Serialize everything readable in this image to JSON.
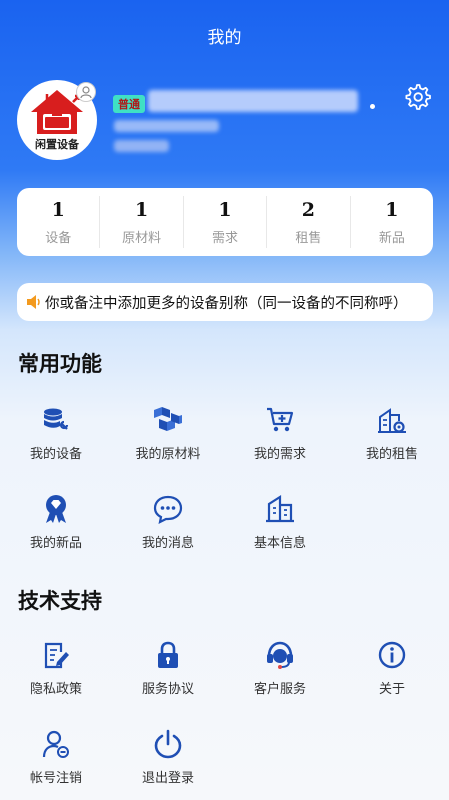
{
  "header": {
    "title": "我的"
  },
  "profile": {
    "logo_text": "闲置设备",
    "level": "普通"
  },
  "stats": [
    {
      "value": "1",
      "label": "设备"
    },
    {
      "value": "1",
      "label": "原材料"
    },
    {
      "value": "1",
      "label": "需求"
    },
    {
      "value": "2",
      "label": "租售"
    },
    {
      "value": "1",
      "label": "新品"
    }
  ],
  "notice": {
    "text": "你或备注中添加更多的设备别称（同一设备的不同称呼）"
  },
  "common": {
    "title": "常用功能",
    "items": [
      {
        "label": "我的设备",
        "icon": "database-wrench-icon"
      },
      {
        "label": "我的原材料",
        "icon": "boxes-icon"
      },
      {
        "label": "我的需求",
        "icon": "cart-plus-icon"
      },
      {
        "label": "我的租售",
        "icon": "building-gear-icon"
      },
      {
        "label": "我的新品",
        "icon": "award-diamond-icon"
      },
      {
        "label": "我的消息",
        "icon": "chat-bubble-icon"
      },
      {
        "label": "基本信息",
        "icon": "building-icon"
      }
    ]
  },
  "support": {
    "title": "技术支持",
    "items": [
      {
        "label": "隐私政策",
        "icon": "document-pen-icon"
      },
      {
        "label": "服务协议",
        "icon": "lock-icon"
      },
      {
        "label": "客户服务",
        "icon": "headset-icon"
      },
      {
        "label": "关于",
        "icon": "info-icon"
      },
      {
        "label": "帐号注销",
        "icon": "user-minus-icon"
      },
      {
        "label": "退出登录",
        "icon": "power-icon"
      }
    ]
  },
  "colors": {
    "primary": "#1a63f0",
    "icon": "#1f4fb4",
    "brand_red": "#d81e1e"
  }
}
